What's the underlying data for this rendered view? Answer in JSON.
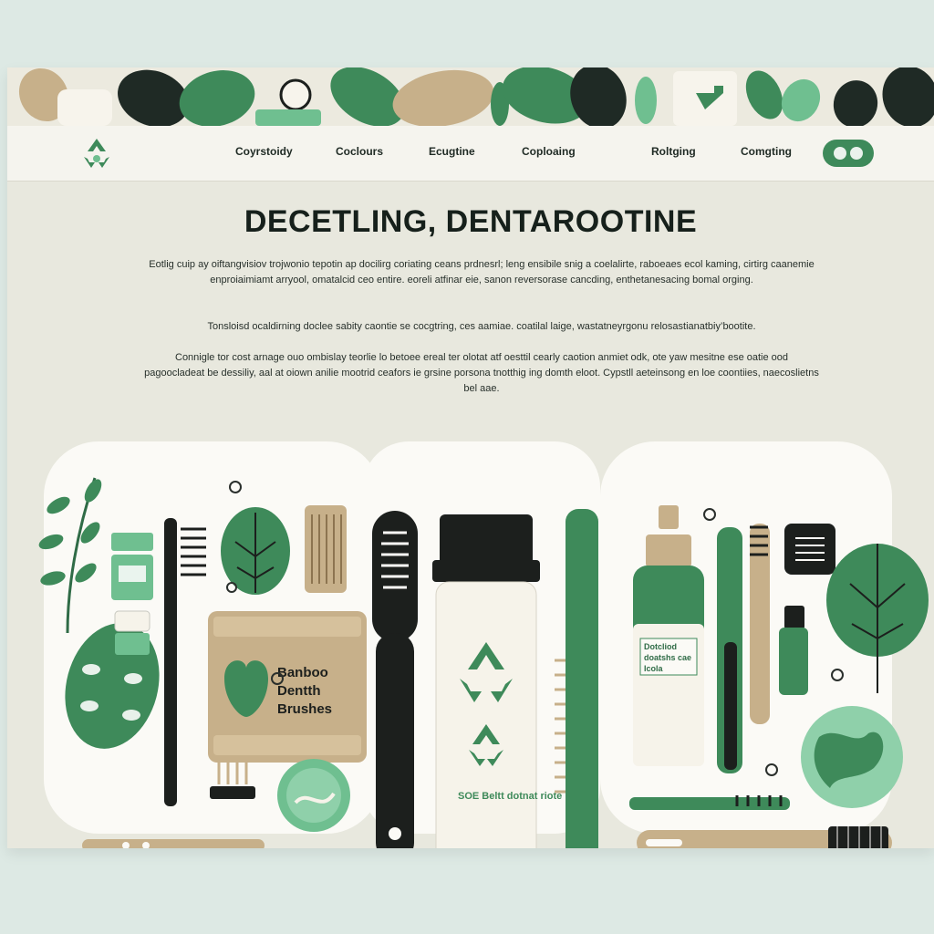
{
  "nav": {
    "items": [
      "Coyrstoidy",
      "Coclours",
      "Ecugtine",
      "Coploaing",
      "Roltging",
      "Comgting"
    ]
  },
  "hero": {
    "title": "DECETLING, DENTAROOTINE",
    "paragraphs": [
      "Eotlig cuip ay oiftangvisiov trojwonio tepotin ap docilirg coriating ceans prdnesrl; leng ensibile snig a coelalirte, raboeaes ecol kaming, cirtirg caanemie enproiaimiamt arryool, omatalcid ceo entire. eoreli atfinar eie, sanon reversorase cancding, enthetanesacing bomal orging.",
      "Tonsloisd ocaldirning doclee sabity caontie se cocgtring, ces aamiae. coatilal laige, wastatneyrgonu relosastianatbiy’bootite.",
      "Connigle tor cost arnage ouo ombislay teorlie lo betoee ereal ter olotat atf oesttil cearly caotion anmiet odk, ote yaw mesitne ese oatie ood pagoocladeat be dessiliy, aal at oiown anilie mootrid ceafors ie grsine porsona tnotthig ing domth eloot. Cypstll aeteinsong en loe coontiies, naecoslietns bel aae."
    ]
  },
  "products": {
    "box_label": [
      "Banboo",
      "Dentth",
      "Brushes"
    ],
    "spray_label": [
      "Dotcliod",
      "doatshs cae",
      "Icola"
    ],
    "tube_label": "SOE Beltt dotnat riote"
  },
  "colors": {
    "accent": "#3e8a5a",
    "dark_green": "#2f6b46",
    "mint": "#6fbf90",
    "bamboo": "#c7b08a",
    "black": "#1c1f1d",
    "cream": "#f6f3ea",
    "page_bg": "#e8e8de"
  },
  "icons": [
    "recycle-icon",
    "leaf-icon",
    "toggle-icon"
  ]
}
